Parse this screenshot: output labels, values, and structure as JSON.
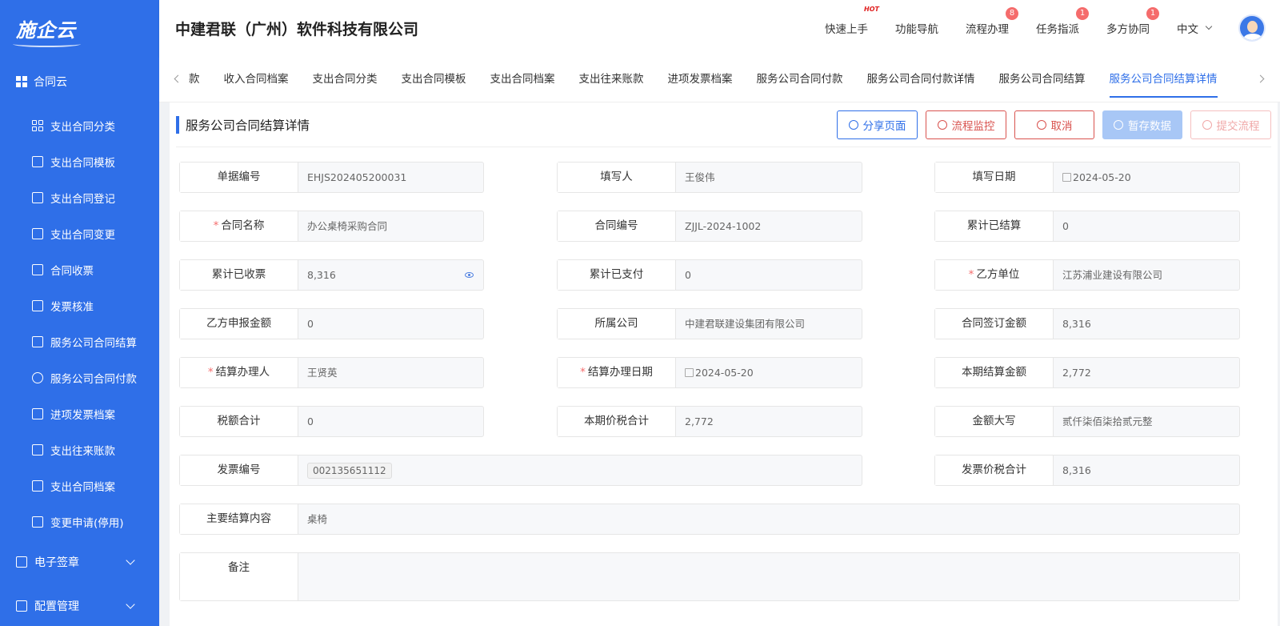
{
  "logo": "施企云",
  "sidebar": {
    "group": "合同云",
    "items": [
      {
        "label": "支出合同分类"
      },
      {
        "label": "支出合同模板"
      },
      {
        "label": "支出合同登记"
      },
      {
        "label": "支出合同变更"
      },
      {
        "label": "合同收票"
      },
      {
        "label": "发票核准"
      },
      {
        "label": "服务公司合同结算"
      },
      {
        "label": "服务公司合同付款"
      },
      {
        "label": "进项发票档案"
      },
      {
        "label": "支出往来账款"
      },
      {
        "label": "支出合同档案"
      },
      {
        "label": "变更申请(停用)"
      }
    ],
    "subgroups": [
      {
        "label": "电子签章"
      },
      {
        "label": "配置管理"
      }
    ]
  },
  "header": {
    "company": "中建君联（广州）软件科技有限公司",
    "nav": [
      {
        "label": "快速上手",
        "badge": "HOT"
      },
      {
        "label": "功能导航",
        "badge": ""
      },
      {
        "label": "流程办理",
        "badge": "8"
      },
      {
        "label": "任务指派",
        "badge": "1"
      },
      {
        "label": "多方协同",
        "badge": "1"
      }
    ],
    "lang": "中文"
  },
  "tabs": {
    "clipped": "款",
    "items": [
      "收入合同档案",
      "支出合同分类",
      "支出合同模板",
      "支出合同档案",
      "支出往来账款",
      "进项发票档案",
      "服务公司合同付款",
      "服务公司合同付款详情",
      "服务公司合同结算",
      "服务公司合同结算详情"
    ],
    "active": "服务公司合同结算详情"
  },
  "page": {
    "title": "服务公司合同结算详情",
    "buttons": {
      "share": "分享页面",
      "monitor": "流程监控",
      "cancel": "取消",
      "save": "暂存数据",
      "submit": "提交流程"
    }
  },
  "form": {
    "doc_no": {
      "label": "单据编号",
      "value": "EHJS202405200031"
    },
    "filler": {
      "label": "填写人",
      "value": "王俊伟"
    },
    "fill_date": {
      "label": "填写日期",
      "value": "2024-05-20"
    },
    "contract_name": {
      "label": "合同名称",
      "value": "办公桌椅采购合同"
    },
    "contract_no": {
      "label": "合同编号",
      "value": "ZJJL-2024-1002"
    },
    "total_settled": {
      "label": "累计已结算",
      "value": "0"
    },
    "total_received_invoice": {
      "label": "累计已收票",
      "value": "8,316"
    },
    "total_paid": {
      "label": "累计已支付",
      "value": "0"
    },
    "party_b": {
      "label": "乙方单位",
      "value": "江苏浦业建设有限公司"
    },
    "party_b_amount": {
      "label": "乙方申报金额",
      "value": "0"
    },
    "company": {
      "label": "所属公司",
      "value": "中建君联建设集团有限公司"
    },
    "contract_amount": {
      "label": "合同签订金额",
      "value": "8,316"
    },
    "handler": {
      "label": "结算办理人",
      "value": "王贤英"
    },
    "handle_date": {
      "label": "结算办理日期",
      "value": "2024-05-20"
    },
    "period_amount": {
      "label": "本期结算金额",
      "value": "2,772"
    },
    "tax_total": {
      "label": "税额合计",
      "value": "0"
    },
    "period_price_tax": {
      "label": "本期价税合计",
      "value": "2,772"
    },
    "amount_upper": {
      "label": "金额大写",
      "value": "贰仟柒佰柒拾贰元整"
    },
    "invoice_no": {
      "label": "发票编号",
      "value": "002135651112"
    },
    "invoice_price_tax": {
      "label": "发票价税合计",
      "value": "8,316"
    },
    "main_content": {
      "label": "主要结算内容",
      "value": "桌椅"
    },
    "remark": {
      "label": "备注",
      "value": ""
    }
  }
}
